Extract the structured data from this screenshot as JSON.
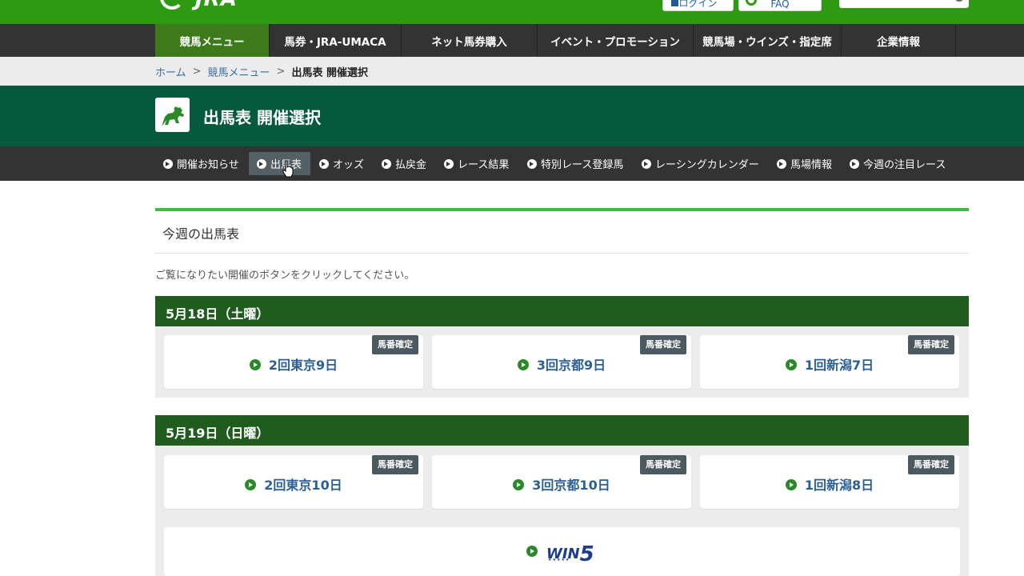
{
  "header": {
    "logo_text": "JRA",
    "login_label": "ログイン",
    "faq_label": "FAQ"
  },
  "main_nav": [
    {
      "label": "競馬メニュー",
      "active": true
    },
    {
      "label": "馬券・JRA-UMACA",
      "active": false
    },
    {
      "label": "ネット馬券購入",
      "active": false
    },
    {
      "label": "イベント・プロモーション",
      "active": false
    },
    {
      "label": "競馬場・ウインズ・指定席",
      "active": false
    },
    {
      "label": "企業情報",
      "active": false
    }
  ],
  "breadcrumb": {
    "home": "ホーム",
    "sep": ">",
    "menu": "競馬メニュー",
    "current": "出馬表 開催選択"
  },
  "page": {
    "title": "出馬表 開催選択"
  },
  "sub_nav": [
    {
      "label": "開催お知らせ",
      "active": false
    },
    {
      "label": "出馬表",
      "active": true
    },
    {
      "label": "オッズ",
      "active": false
    },
    {
      "label": "払戻金",
      "active": false
    },
    {
      "label": "レース結果",
      "active": false
    },
    {
      "label": "特別レース登録馬",
      "active": false
    },
    {
      "label": "レーシングカレンダー",
      "active": false
    },
    {
      "label": "馬場情報",
      "active": false
    },
    {
      "label": "今週の注目レース",
      "active": false
    }
  ],
  "content": {
    "section_title": "今週の出馬表",
    "intro": "ご覧になりたい開催のボタンをクリックしてください。",
    "days": [
      {
        "date": "5月18日（土曜）",
        "meetings": [
          {
            "label": "2回東京9日",
            "badge": "馬番確定"
          },
          {
            "label": "3回京都9日",
            "badge": "馬番確定"
          },
          {
            "label": "1回新潟7日",
            "badge": "馬番確定"
          }
        ]
      },
      {
        "date": "5月19日（日曜）",
        "meetings": [
          {
            "label": "2回東京10日",
            "badge": "馬番確定"
          },
          {
            "label": "3回京都10日",
            "badge": "馬番確定"
          },
          {
            "label": "1回新潟8日",
            "badge": "馬番確定"
          }
        ]
      }
    ],
    "win5": {
      "logo_text": "WIN",
      "logo_digit": "5"
    }
  },
  "colors": {
    "brand_green": "#2e9a12",
    "page_header": "#055a3e",
    "day_header": "#1f5c1d",
    "link_blue": "#2c5f94",
    "badge": "#4b5960"
  }
}
